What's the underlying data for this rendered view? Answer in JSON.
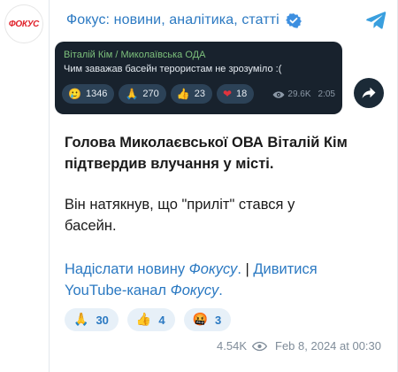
{
  "avatar": {
    "logo_text": "ФОКУС"
  },
  "header": {
    "channel_name": "Фокус: новини, аналітика, статті",
    "verified_icon": "verified-badge-icon",
    "app_icon": "telegram-icon"
  },
  "forwarded": {
    "author": "Віталій Кім / Миколаївська ОДА",
    "text": "Чим заважав басейн терористам не зрозуміло :(",
    "reactions": [
      {
        "emoji": "🥲",
        "count": "1346"
      },
      {
        "emoji": "🙏",
        "count": "270"
      },
      {
        "emoji": "👍",
        "count": "23"
      },
      {
        "emoji": "❤",
        "count": "18"
      }
    ],
    "views": "29.6K",
    "time": "2:05",
    "share_icon": "share-arrow-icon"
  },
  "post": {
    "headline_line1": "Голова Миколаєвської ОВА Віталій Кім",
    "headline_line2": "підтвердив влучання у місті.",
    "text_line1": "Він натякнув, що \"приліт\" стався у",
    "text_line2": "басейн.",
    "link1_text": "Надіслати новину ",
    "link1_italic": "Фокусу",
    "link1_end": ".",
    "separator": " | ",
    "link2_text": "Дивитися",
    "link3_text": "YouTube-канал ",
    "link3_italic": "Фокусу",
    "link3_end": "."
  },
  "reactions": [
    {
      "emoji": "🙏",
      "count": "30"
    },
    {
      "emoji": "👍",
      "count": "4"
    },
    {
      "emoji": "🤬",
      "count": "3"
    }
  ],
  "footer": {
    "views": "4.54K",
    "date": "Feb 8, 2024 at 00:30"
  },
  "colors": {
    "link": "#2b79c2",
    "forward_bg": "#18222d",
    "reaction_bg": "#e7f0f8",
    "brand_red": "#e0222b"
  }
}
